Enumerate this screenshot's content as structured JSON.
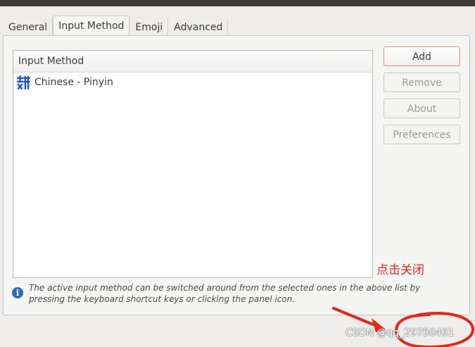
{
  "tabs": [
    {
      "label": "General",
      "active": false
    },
    {
      "label": "Input Method",
      "active": true
    },
    {
      "label": "Emoji",
      "active": false
    },
    {
      "label": "Advanced",
      "active": false
    }
  ],
  "list": {
    "header": "Input Method",
    "items": [
      {
        "label": "Chinese - Pinyin",
        "icon": "pinyin-icon"
      }
    ]
  },
  "buttons": {
    "add": "Add",
    "remove": "Remove",
    "about": "About",
    "preferences": "Preferences"
  },
  "info": {
    "icon": "info-icon",
    "text": "The active input method can be switched around from the selected ones in the above list by pressing the keyboard shortcut keys or clicking the panel icon."
  },
  "annotation": {
    "text": "点击关闭",
    "color": "#e0281c"
  },
  "watermark": "CSDN @qq_29750461"
}
